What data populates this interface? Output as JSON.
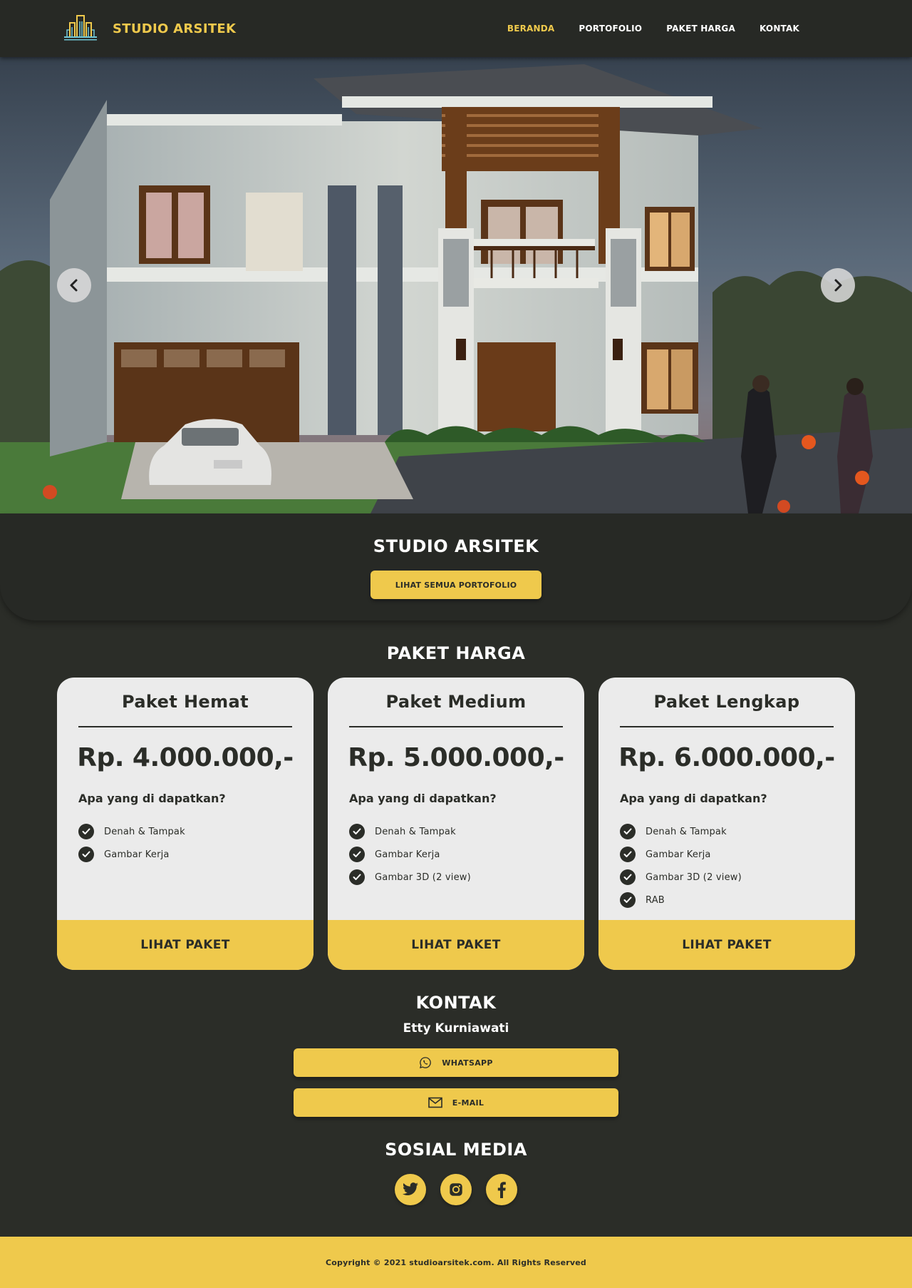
{
  "brand": {
    "name": "STUDIO ARSITEK",
    "logo_icon": "building-logo-icon"
  },
  "nav": {
    "items": [
      {
        "label": "BERANDA",
        "active": true
      },
      {
        "label": "PORTOFOLIO",
        "active": false
      },
      {
        "label": "PAKET HARGA",
        "active": false
      },
      {
        "label": "KONTAK",
        "active": false
      }
    ]
  },
  "hero": {
    "image": "two-story-house-rendering",
    "prev_icon": "chevron-left-icon",
    "next_icon": "chevron-right-icon"
  },
  "studio": {
    "title": "STUDIO ARSITEK",
    "button_label": "LIHAT SEMUA PORTOFOLIO"
  },
  "pricing": {
    "title": "PAKET HARGA",
    "cards": [
      {
        "name": "Paket Hemat",
        "price": "Rp. 4.000.000,-",
        "subtitle": "Apa yang di dapatkan?",
        "features": [
          "Denah & Tampak",
          "Gambar Kerja"
        ],
        "cta": "LIHAT PAKET"
      },
      {
        "name": "Paket Medium",
        "price": "Rp. 5.000.000,-",
        "subtitle": "Apa yang di dapatkan?",
        "features": [
          "Denah & Tampak",
          "Gambar Kerja",
          "Gambar 3D (2 view)"
        ],
        "cta": "LIHAT PAKET"
      },
      {
        "name": "Paket Lengkap",
        "price": "Rp. 6.000.000,-",
        "subtitle": "Apa yang di dapatkan?",
        "features": [
          "Denah & Tampak",
          "Gambar Kerja",
          "Gambar 3D (2 view)",
          "RAB"
        ],
        "cta": "LIHAT PAKET"
      }
    ]
  },
  "contact": {
    "title": "KONTAK",
    "name": "Etty Kurniawati",
    "whatsapp_label": "WHATSAPP",
    "email_label": "E-MAIL"
  },
  "social": {
    "title": "SOSIAL MEDIA",
    "icons": [
      "twitter-icon",
      "instagram-icon",
      "facebook-icon"
    ]
  },
  "footer": {
    "text": "Copyright © 2021 studioarsitek.com. All Rights Reserved"
  },
  "colors": {
    "accent": "#efc94c",
    "background": "#2b2d28",
    "card": "#ebebeb",
    "navbar": "#272925"
  }
}
